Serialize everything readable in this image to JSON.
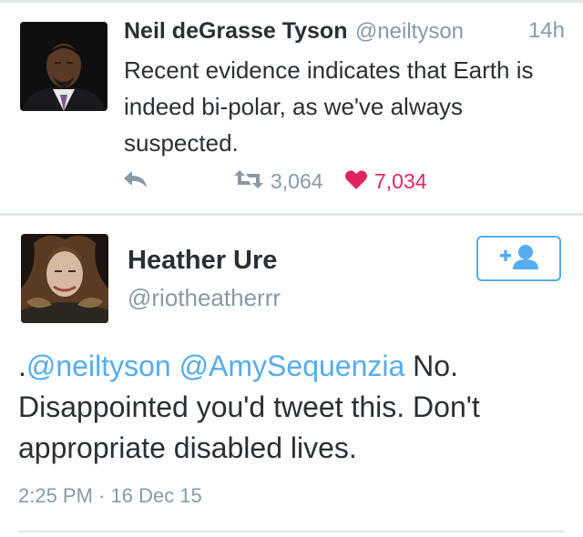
{
  "tweet1": {
    "name": "Neil deGrasse Tyson",
    "handle": "@neiltyson",
    "time": "14h",
    "text": "Recent evidence indicates that Earth is indeed bi-polar, as we've always suspected.",
    "retweets": "3,064",
    "likes": "7,034",
    "icons": {
      "reply": "reply-icon",
      "retweet": "retweet-icon",
      "like": "heart-icon"
    }
  },
  "tweet2": {
    "name": "Heather Ure",
    "handle": "@riotheatherrr",
    "text_prefix": ".",
    "mention1": "@neiltyson",
    "mention2": "@AmySequenzia",
    "text_body": "No. Disappointed you'd tweet this. Don't appropriate disabled lives.",
    "timestamp": "2:25 PM · 16 Dec 15",
    "follow_icon": "follow-user-icon"
  },
  "colors": {
    "accent": "#55acee",
    "heart": "#e0245e",
    "muted": "#8899a6",
    "text": "#292f33",
    "divider": "#e1e8ed"
  }
}
